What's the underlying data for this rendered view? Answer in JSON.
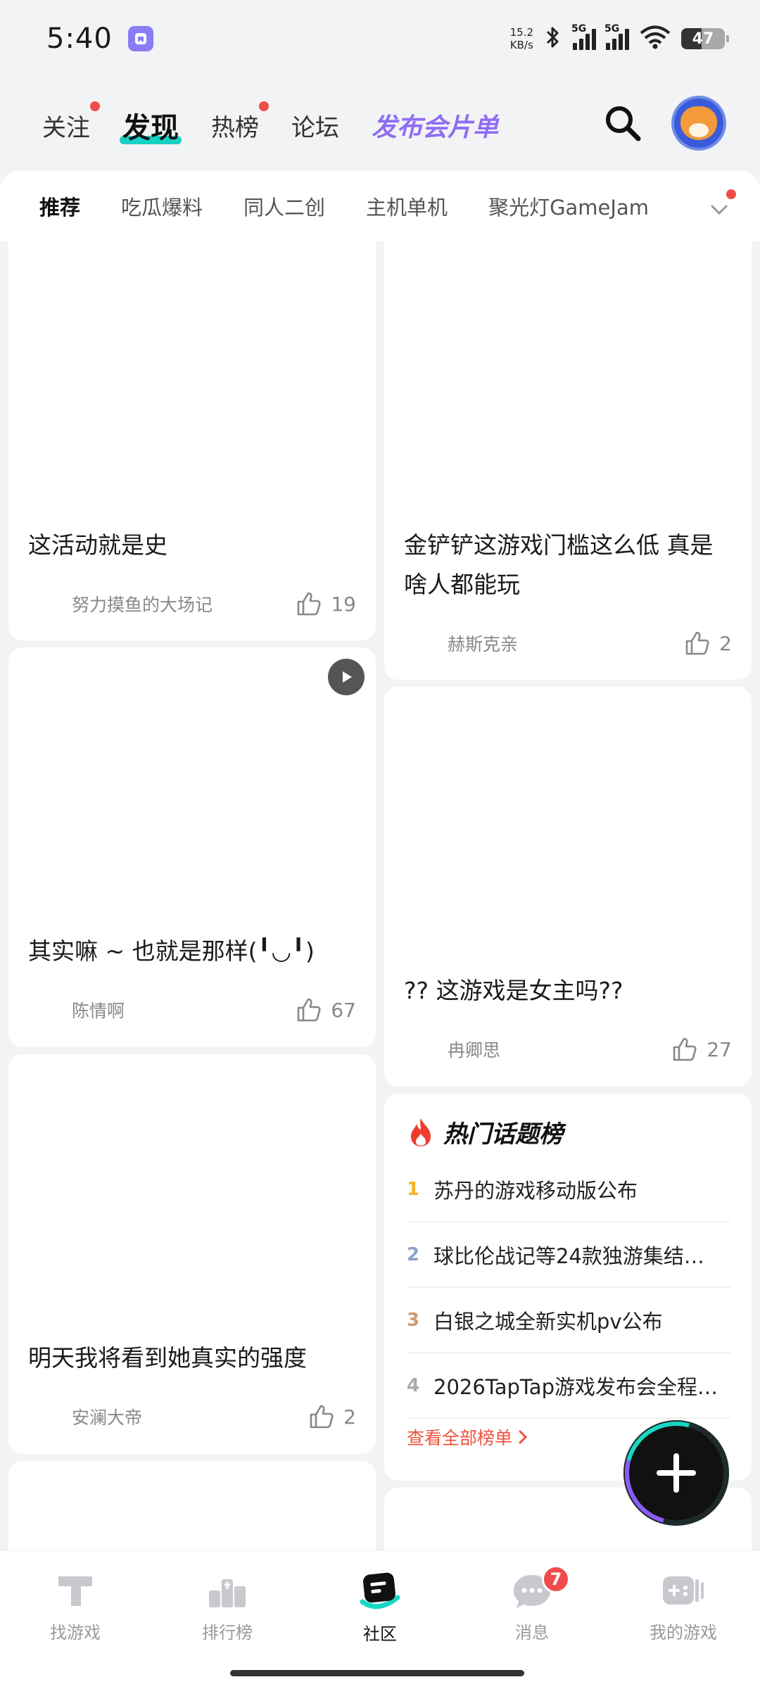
{
  "status_bar": {
    "time": "5:40",
    "net_speed_value": "15.2",
    "net_speed_unit": "KB/s",
    "signal_1": "5G",
    "signal_2": "5G",
    "wifi_level": "6",
    "battery": "47"
  },
  "top_nav": {
    "tabs": [
      {
        "label": "关注",
        "has_dot": true
      },
      {
        "label": "发现",
        "active": true
      },
      {
        "label": "热榜",
        "has_dot": true
      },
      {
        "label": "论坛"
      },
      {
        "label": "发布会片单",
        "special": true
      }
    ]
  },
  "sub_tabs": {
    "items": [
      "推荐",
      "吃瓜爆料",
      "同人二创",
      "主机单机",
      "聚光灯GameJam"
    ],
    "active_index": 0
  },
  "feed": {
    "left": [
      {
        "title": "这活动就是史",
        "author": "努力摸鱼的大场记",
        "likes": "19"
      },
      {
        "title": "其实嘛 ~ 也就是那样(╹◡╹)",
        "author": "陈情啊",
        "likes": "67",
        "video": true
      },
      {
        "title": "明天我将看到她真实的强度",
        "author": "安澜大帝",
        "likes": "2"
      }
    ],
    "right": [
      {
        "title": "金铲铲这游戏门槛这么低 真是啥人都能玩",
        "author": "赫斯克亲",
        "likes": "2"
      },
      {
        "title": "?? 这游戏是女主吗??",
        "author": "冉卿思",
        "likes": "27"
      }
    ]
  },
  "hot_topics": {
    "title": "热门话题榜",
    "items": [
      {
        "rank": "1",
        "text": "苏丹的游戏移动版公布"
      },
      {
        "rank": "2",
        "text": "球比伦战记等24款独游集结…"
      },
      {
        "rank": "3",
        "text": "白银之城全新实机pv公布"
      },
      {
        "rank": "4",
        "text": "2026TapTap游戏发布会全程…"
      }
    ],
    "view_all": "查看全部榜单",
    "rank_colors": [
      "#f2b626",
      "#8aa4c8",
      "#d09a6a",
      "#aaaaaa"
    ]
  },
  "bottom_nav": {
    "items": [
      {
        "label": "找游戏"
      },
      {
        "label": "排行榜"
      },
      {
        "label": "社区",
        "active": true
      },
      {
        "label": "消息",
        "badge": "7"
      },
      {
        "label": "我的游戏"
      }
    ]
  },
  "colors": {
    "accent_teal": "#17d1c6",
    "accent_purple": "#8f6cf4",
    "red_dot": "#f24b4b",
    "link_red": "#f0503c"
  }
}
